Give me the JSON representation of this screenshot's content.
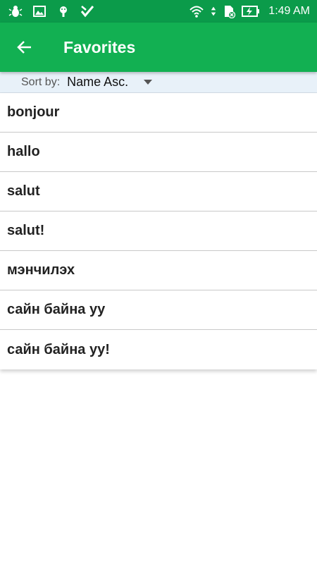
{
  "status_bar": {
    "time": "1:49 AM",
    "icons": [
      "bug-notification-icon",
      "image-notification-icon",
      "android-notification-icon",
      "check-notification-icon",
      "wifi-icon",
      "data-arrows-icon",
      "no-sim-icon",
      "battery-charging-icon"
    ]
  },
  "app_bar": {
    "title": "Favorites",
    "back_icon": "back-arrow-icon"
  },
  "sort": {
    "label": "Sort by:",
    "selected": "Name Asc."
  },
  "favorites": [
    "bonjour",
    "hallo",
    "salut",
    "salut!",
    "мэнчилэх",
    "сайн байна уу",
    "сайн байна уу!"
  ],
  "colors": {
    "status_bar": "#0b9b4a",
    "app_bar": "#12b052",
    "sort_bar": "#e8f1f9"
  }
}
